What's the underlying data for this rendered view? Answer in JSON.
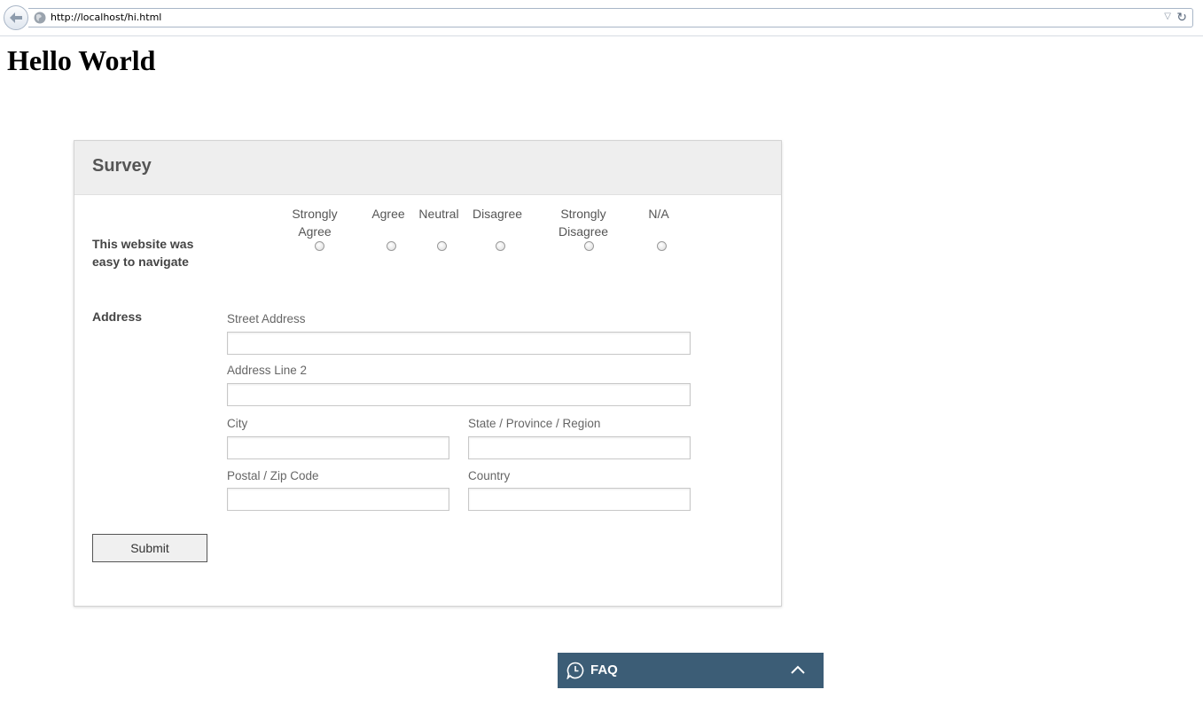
{
  "browser": {
    "url": "http://localhost/hi.html",
    "back_icon": "back-arrow-icon",
    "site_icon": "globe-icon",
    "reload_icon": "reload-icon"
  },
  "page": {
    "title": "Hello World"
  },
  "survey": {
    "title": "Survey",
    "question": "This website was easy to navigate",
    "options": [
      {
        "label": "Strongly Agree"
      },
      {
        "label": "Agree"
      },
      {
        "label": "Neutral"
      },
      {
        "label": "Disagree"
      },
      {
        "label": "Strongly Disagree"
      },
      {
        "label": "N/A"
      }
    ],
    "address_label": "Address",
    "fields": {
      "street": "Street Address",
      "line2": "Address Line 2",
      "city": "City",
      "state": "State / Province / Region",
      "zip": "Postal / Zip Code",
      "country": "Country"
    },
    "submit_label": "Submit"
  },
  "faq": {
    "label": "FAQ",
    "icon": "clock-bubble-icon",
    "toggle_icon": "chevron-up-icon"
  },
  "colors": {
    "faq_background": "#3c5d76",
    "card_header": "#eeeeee"
  }
}
